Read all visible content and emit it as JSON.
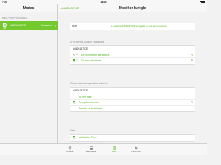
{
  "status_bar": {
    "carrier": "iPad",
    "time": "16:08"
  },
  "left_panel": {
    "title": "Modes",
    "section_title": "MES PÉRIPHÉRIQUES",
    "device": {
      "name": "#462615707E",
      "state": "Désactivé"
    }
  },
  "right_panel": {
    "back_label": "#462615707E",
    "title": "Modifier la règle",
    "name_row": {
      "label": "Nom",
      "value": "La caméra #462615707E enregistre en cas de mouvement"
    },
    "triggers_label": "Si les critères suivants s'appliquent",
    "trigger_device": "#462615707E",
    "triggers": [
      {
        "label": "Du mouvement est détecté",
        "checked": true
      },
      {
        "label": "Du son est détecté",
        "checked": true
      }
    ],
    "actions_label": "Effectuer la ou les opérations suivantes",
    "action_device": "#462615707E",
    "actions": [
      {
        "label": "Ne rien faire",
        "selected": false
      },
      {
        "label": "Enregistrer la vidéo",
        "selected": true
      },
      {
        "label": "Prendre un instantané",
        "selected": false
      }
    ],
    "alert_label": "Alerte",
    "alert": {
      "label": "Notification Push",
      "checked": true
    }
  },
  "tab_bar": {
    "tabs": [
      {
        "label": "Caméras",
        "icon": "camera-icon"
      },
      {
        "label": "Bibliothèque",
        "icon": "library-icon"
      },
      {
        "label": "Mode",
        "icon": "mode-icon",
        "active": true
      },
      {
        "label": "Paramètres",
        "icon": "settings-icon"
      }
    ]
  },
  "colors": {
    "accent": "#52b41b",
    "selected_row": "#73c92d",
    "background": "#f2f2f2"
  }
}
